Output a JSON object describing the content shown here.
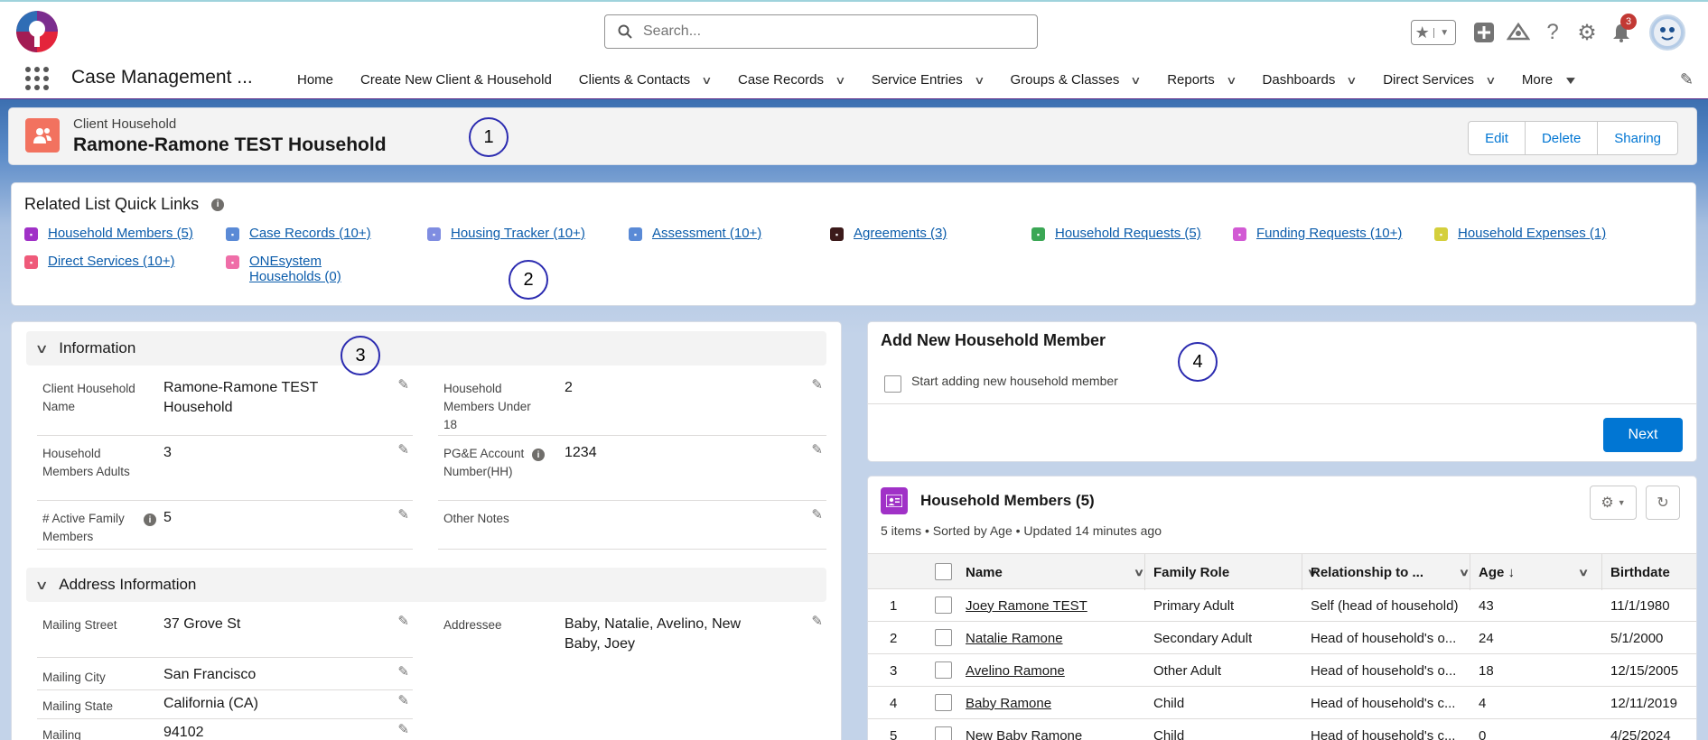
{
  "header": {
    "search_placeholder": "Search...",
    "notification_count": "3"
  },
  "nav": {
    "app_name": "Case Management ...",
    "items": [
      {
        "label": "Home",
        "dropdown": false
      },
      {
        "label": "Create New Client & Household",
        "dropdown": false
      },
      {
        "label": "Clients & Contacts",
        "dropdown": true
      },
      {
        "label": "Case Records",
        "dropdown": true
      },
      {
        "label": "Service Entries",
        "dropdown": true
      },
      {
        "label": "Groups & Classes",
        "dropdown": true
      },
      {
        "label": "Reports",
        "dropdown": true
      },
      {
        "label": "Dashboards",
        "dropdown": true
      },
      {
        "label": "Direct Services",
        "dropdown": true
      },
      {
        "label": "More",
        "dropdown": true
      }
    ]
  },
  "record": {
    "type": "Client Household",
    "title": "Ramone-Ramone TEST Household",
    "actions": [
      "Edit",
      "Delete",
      "Sharing"
    ]
  },
  "annotations": [
    "1",
    "2",
    "3",
    "4"
  ],
  "quick_links": {
    "title": "Related List Quick Links",
    "links": [
      {
        "label": "Household Members (5)",
        "color": "#a031c7"
      },
      {
        "label": "Case Records (10+)",
        "color": "#5a8ad6"
      },
      {
        "label": "Housing Tracker (10+)",
        "color": "#7f8de1"
      },
      {
        "label": "Assessment (10+)",
        "color": "#5a8ad6"
      },
      {
        "label": "Agreements (3)",
        "color": "#3c1a1a"
      },
      {
        "label": "Household Requests (5)",
        "color": "#3ba755"
      },
      {
        "label": "Funding Requests (10+)",
        "color": "#d25ad4"
      },
      {
        "label": "Household Expenses (1)",
        "color": "#d4cf3c"
      },
      {
        "label": "Direct Services (10+)",
        "color": "#ef5a7a"
      },
      {
        "label": "ONEsystem Households (0)",
        "color": "#ef6ea8"
      }
    ]
  },
  "information": {
    "section_title": "Information",
    "fields": [
      {
        "label": "Client Household Name",
        "value": "Ramone-Ramone TEST Household"
      },
      {
        "label": "Household Members Under 18",
        "value": "2"
      },
      {
        "label": "Household Members Adults",
        "value": "3"
      },
      {
        "label": "PG&E Account Number(HH)",
        "value": "1234"
      },
      {
        "label": "# Active Family Members",
        "value": "5"
      },
      {
        "label": "Other Notes",
        "value": ""
      }
    ]
  },
  "address": {
    "section_title": "Address Information",
    "fields": [
      {
        "label": "Mailing Street",
        "value": "37 Grove St"
      },
      {
        "label": "Addressee",
        "value": "Baby, Natalie, Avelino, New Baby, Joey"
      },
      {
        "label": "Mailing City",
        "value": "San Francisco"
      },
      {
        "label": "Mailing State",
        "value": "California (CA)"
      },
      {
        "label": "Mailing",
        "value": "94102"
      }
    ]
  },
  "add_member": {
    "title": "Add New Household Member",
    "checkbox_label": "Start adding new household member",
    "next_label": "Next"
  },
  "members": {
    "title": "Household Members (5)",
    "subtitle": "5 items • Sorted by Age • Updated 14 minutes ago",
    "columns": [
      "Name",
      "Family Role",
      "Relationship to ...",
      "Age ↓",
      "Birthdate"
    ],
    "rows": [
      {
        "num": "1",
        "name": "Joey Ramone TEST",
        "role": "Primary Adult",
        "rel": "Self (head of household)",
        "age": "43",
        "birth": "11/1/1980"
      },
      {
        "num": "2",
        "name": "Natalie Ramone",
        "role": "Secondary Adult",
        "rel": "Head of household's o...",
        "age": "24",
        "birth": "5/1/2000"
      },
      {
        "num": "3",
        "name": "Avelino Ramone",
        "role": "Other Adult",
        "rel": "Head of household's o...",
        "age": "18",
        "birth": "12/15/2005"
      },
      {
        "num": "4",
        "name": "Baby Ramone",
        "role": "Child",
        "rel": "Head of household's c...",
        "age": "4",
        "birth": "12/11/2019"
      },
      {
        "num": "5",
        "name": "New Baby Ramone",
        "role": "Child",
        "rel": "Head of household's c...",
        "age": "0",
        "birth": "4/25/2024"
      }
    ]
  }
}
